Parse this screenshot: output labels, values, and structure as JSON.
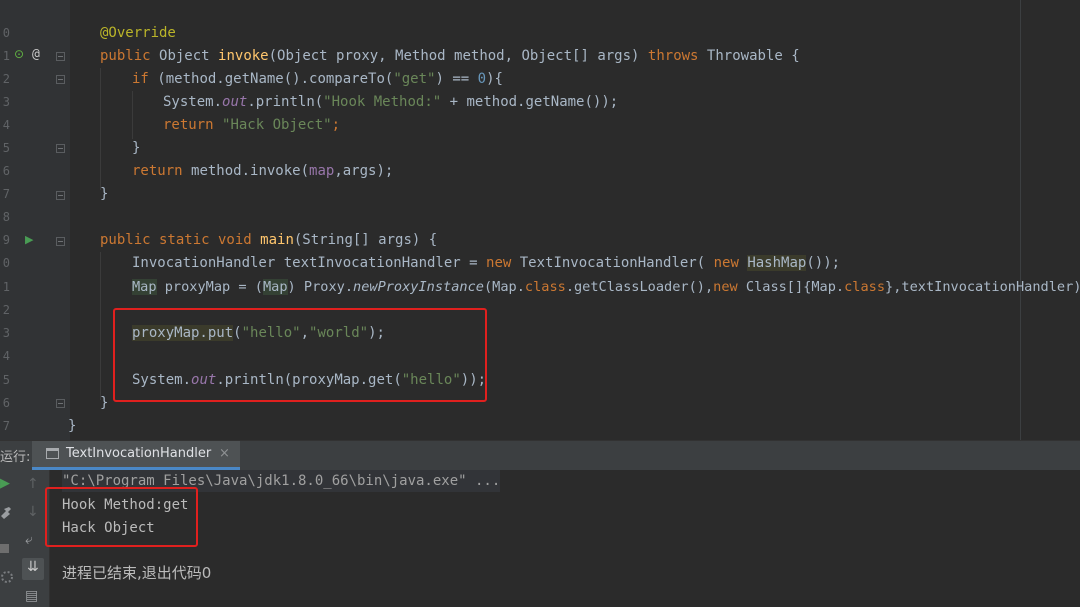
{
  "editor": {
    "line_numbers": [
      "0",
      "1",
      "2",
      "3",
      "4",
      "5",
      "6",
      "7",
      "8",
      "9",
      "0",
      "1",
      "2",
      "3",
      "4",
      "5",
      "6",
      "7"
    ],
    "code": {
      "l_override": "@Override",
      "invoke": {
        "public": "public ",
        "type1": "Object ",
        "name": "invoke",
        "p1": "(Object proxy, Method method, Object[] args) ",
        "throws": "throws ",
        "rest": "Throwable {"
      },
      "if_line": {
        "kw": "if ",
        "a": "(method.getName().compareTo(",
        "str": "\"get\"",
        "b": ") == ",
        "num": "0",
        "c": "){"
      },
      "println1": {
        "a": "System.",
        "out": "out",
        "b": ".println(",
        "str": "\"Hook Method:\"",
        "c": " + method.getName());"
      },
      "return1": {
        "kw": "return ",
        "str": "\"Hack Object\"",
        "c": ";"
      },
      "close_if": "}",
      "return2": {
        "kw": "return ",
        "a": "method.invoke(",
        "fld": "map",
        "b": ",args);"
      },
      "close_method": "}",
      "main": {
        "kw": "public static void ",
        "name": "main",
        "rest": "(String[] args) {"
      },
      "handler_line": {
        "a": "InvocationHandler textInvocationHandler = ",
        "kw": "new ",
        "b": "TextInvocationHandler( ",
        "kw2": "new ",
        "c": "HashMap",
        "d": "());"
      },
      "proxy_line": {
        "a": "Map",
        "b": " proxyMap = (",
        "c": "Map",
        "d": ") Proxy.",
        "e": "newProxyInstance",
        "f": "(Map.",
        "k1": "class",
        "g": ".getClassLoader(),",
        "k2": "new ",
        "h": "Class[]{Map.",
        "k3": "class",
        "i": "},textInvocationHandler);"
      },
      "put_line": {
        "a": "proxyMap.put",
        "b": "(",
        "s1": "\"hello\"",
        "c": ",",
        "s2": "\"world\"",
        "d": ");"
      },
      "get_line": {
        "a": "System.",
        "out": "out",
        "b": ".println(proxyMap.get(",
        "s": "\"hello\"",
        "c": "));"
      },
      "close_main": "}",
      "close_class": "}"
    }
  },
  "run_panel": {
    "label": "运行:",
    "tab_title": "TextInvocationHandler",
    "tab_close": "×",
    "console": {
      "command": "\"C:\\Program Files\\Java\\jdk1.8.0_66\\bin\\java.exe\" ...",
      "out1": "Hook Method:get",
      "out2": "Hack Object",
      "exit": "进程已结束,退出代码0"
    }
  },
  "icons": {
    "override_icon": "⊙",
    "at_icon": "@",
    "run_arrow": "▶",
    "up_arrow": "↑",
    "down_arrow": "↓",
    "wrap_icon": "⤶",
    "sort_icon": "⇊",
    "print_icon": "▤"
  },
  "colors": {
    "background": "#2b2b2b",
    "keyword": "#cc7832",
    "string": "#6a8759",
    "highlight_box": "#e0201e"
  }
}
